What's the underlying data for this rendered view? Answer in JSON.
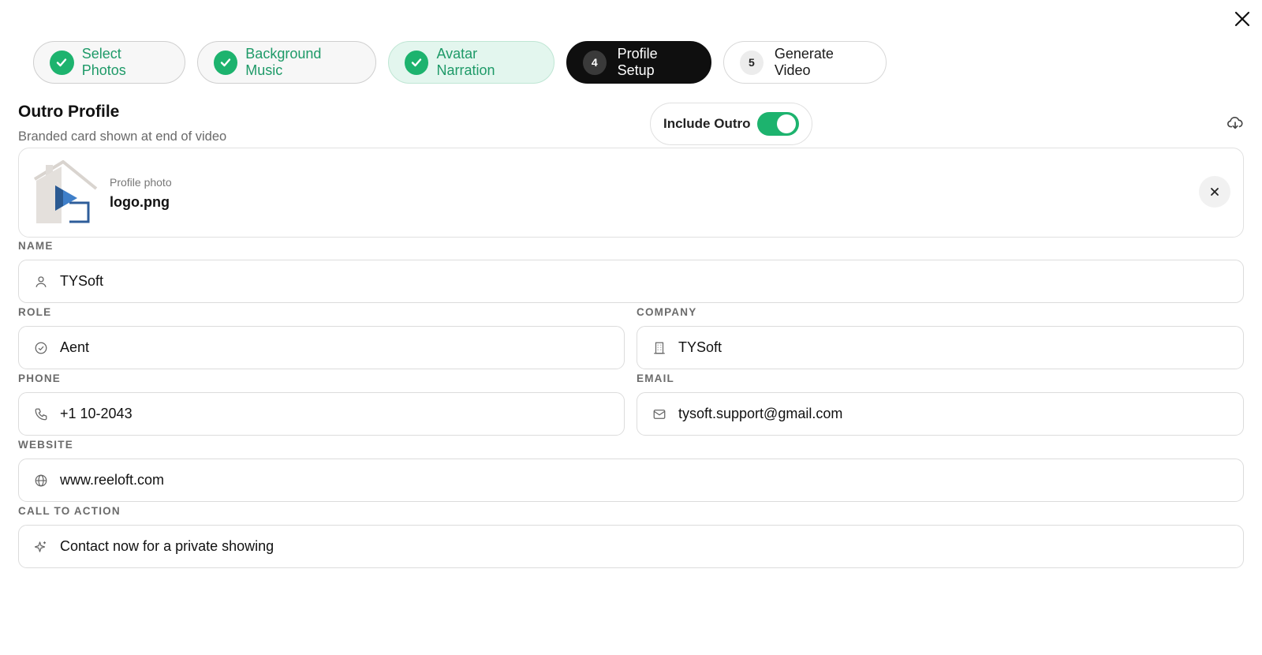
{
  "steps": [
    {
      "number": "1",
      "label": "Select Photos",
      "state": "done"
    },
    {
      "number": "2",
      "label": "Background Music",
      "state": "done"
    },
    {
      "number": "3",
      "label": "Avatar Narration",
      "state": "done"
    },
    {
      "number": "4",
      "label": "Profile Setup",
      "state": "current"
    },
    {
      "number": "5",
      "label": "Generate Video",
      "state": "upcoming"
    }
  ],
  "section": {
    "title": "Outro Profile",
    "subtitle": "Branded card shown at end of video"
  },
  "outro_toggle": {
    "label": "Include Outro",
    "on": true
  },
  "photo": {
    "label": "Profile photo",
    "filename": "logo.png"
  },
  "fields": {
    "name": {
      "label": "NAME",
      "value": "TYSoft",
      "icon": "user-icon"
    },
    "role": {
      "label": "ROLE",
      "value": "Aent",
      "icon": "badge-check-icon"
    },
    "company": {
      "label": "COMPANY",
      "value": "TYSoft",
      "icon": "building-icon"
    },
    "phone": {
      "label": "PHONE",
      "value": "+1 10-2043",
      "icon": "phone-icon"
    },
    "email": {
      "label": "EMAIL",
      "value": "tysoft.support@gmail.com",
      "icon": "mail-icon"
    },
    "website": {
      "label": "WEBSITE",
      "value": "www.reeloft.com",
      "icon": "globe-icon"
    },
    "cta": {
      "label": "CALL TO ACTION",
      "value": "Contact now for a private showing",
      "icon": "sparkle-icon"
    }
  },
  "colors": {
    "accent": "#1db36e",
    "current_step": "#0f0f0f",
    "done_active_bg": "#e3f6ee"
  }
}
